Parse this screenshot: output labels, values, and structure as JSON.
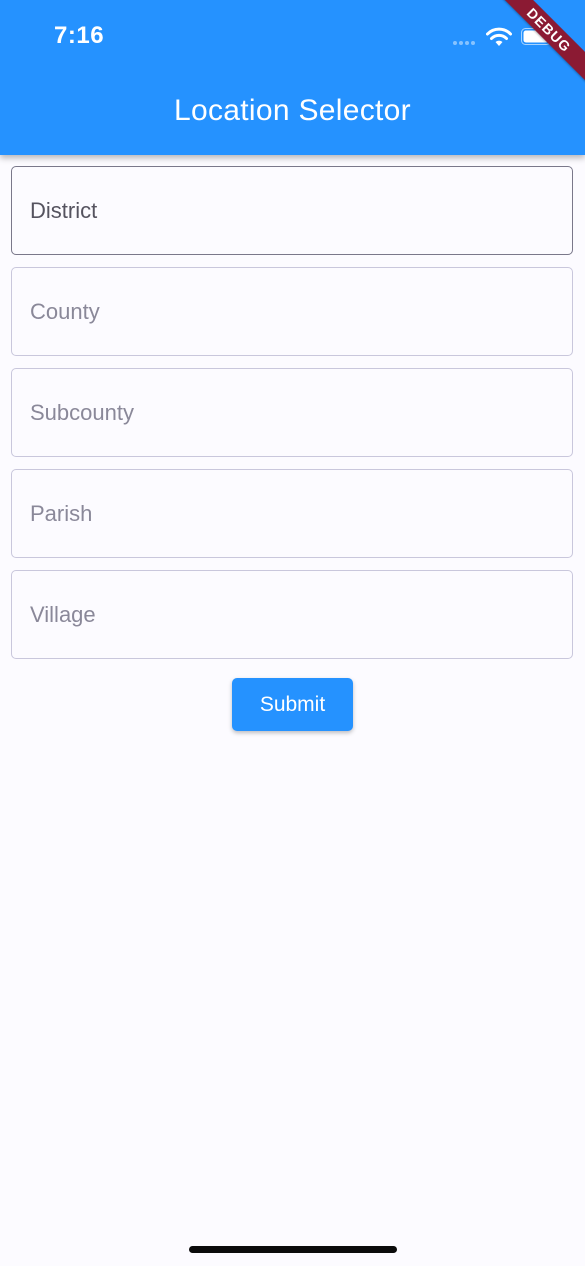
{
  "status_bar": {
    "time": "7:16",
    "wifi_icon": "wifi-icon",
    "battery_icon": "battery-icon"
  },
  "app_bar": {
    "title": "Location Selector",
    "background": "#2592ff",
    "debug_banner": "DEBUG"
  },
  "form": {
    "fields": [
      {
        "placeholder": "District",
        "value": ""
      },
      {
        "placeholder": "County",
        "value": ""
      },
      {
        "placeholder": "Subcounty",
        "value": ""
      },
      {
        "placeholder": "Parish",
        "value": ""
      },
      {
        "placeholder": "Village",
        "value": ""
      }
    ],
    "submit_label": "Submit"
  }
}
